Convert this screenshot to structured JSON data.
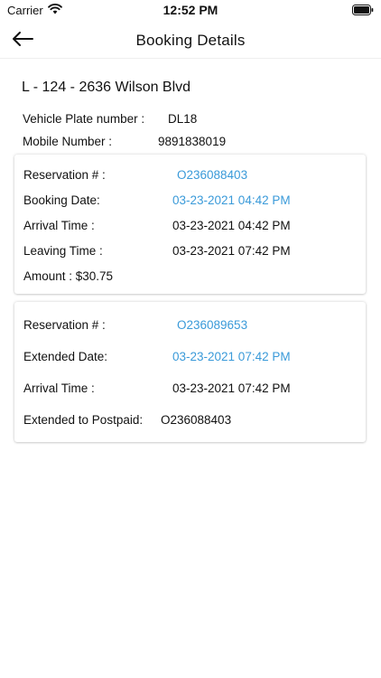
{
  "status_bar": {
    "carrier": "Carrier",
    "time": "12:52 PM",
    "wifi_icon": "wifi-icon",
    "battery_icon": "battery-icon"
  },
  "nav": {
    "title": "Booking Details",
    "back_icon": "back-arrow-icon"
  },
  "location": "L - 124 - 2636 Wilson Blvd",
  "vehicle": {
    "plate_label": "Vehicle Plate number :",
    "plate_value": "DL18",
    "mobile_label": "Mobile Number :",
    "mobile_value": "9891838019"
  },
  "booking_card": {
    "reservation_label": "Reservation # :",
    "reservation_value": "O236088403",
    "booking_date_label": "Booking Date:",
    "booking_date_value": "03-23-2021 04:42 PM",
    "arrival_label": "Arrival Time :",
    "arrival_value": "03-23-2021 04:42 PM",
    "leaving_label": "Leaving Time :",
    "leaving_value": "03-23-2021 07:42 PM",
    "amount": "Amount : $30.75"
  },
  "extension_card": {
    "reservation_label": "Reservation # :",
    "reservation_value": "O236089653",
    "extended_date_label": "Extended Date:",
    "extended_date_value": "03-23-2021 07:42 PM",
    "arrival_label": "Arrival Time :",
    "arrival_value": "03-23-2021 07:42 PM",
    "postpaid_label": "Extended to Postpaid:",
    "postpaid_value": "O236088403"
  },
  "colors": {
    "accent": "#3a9ad9",
    "text": "#111111",
    "background": "#ffffff"
  }
}
